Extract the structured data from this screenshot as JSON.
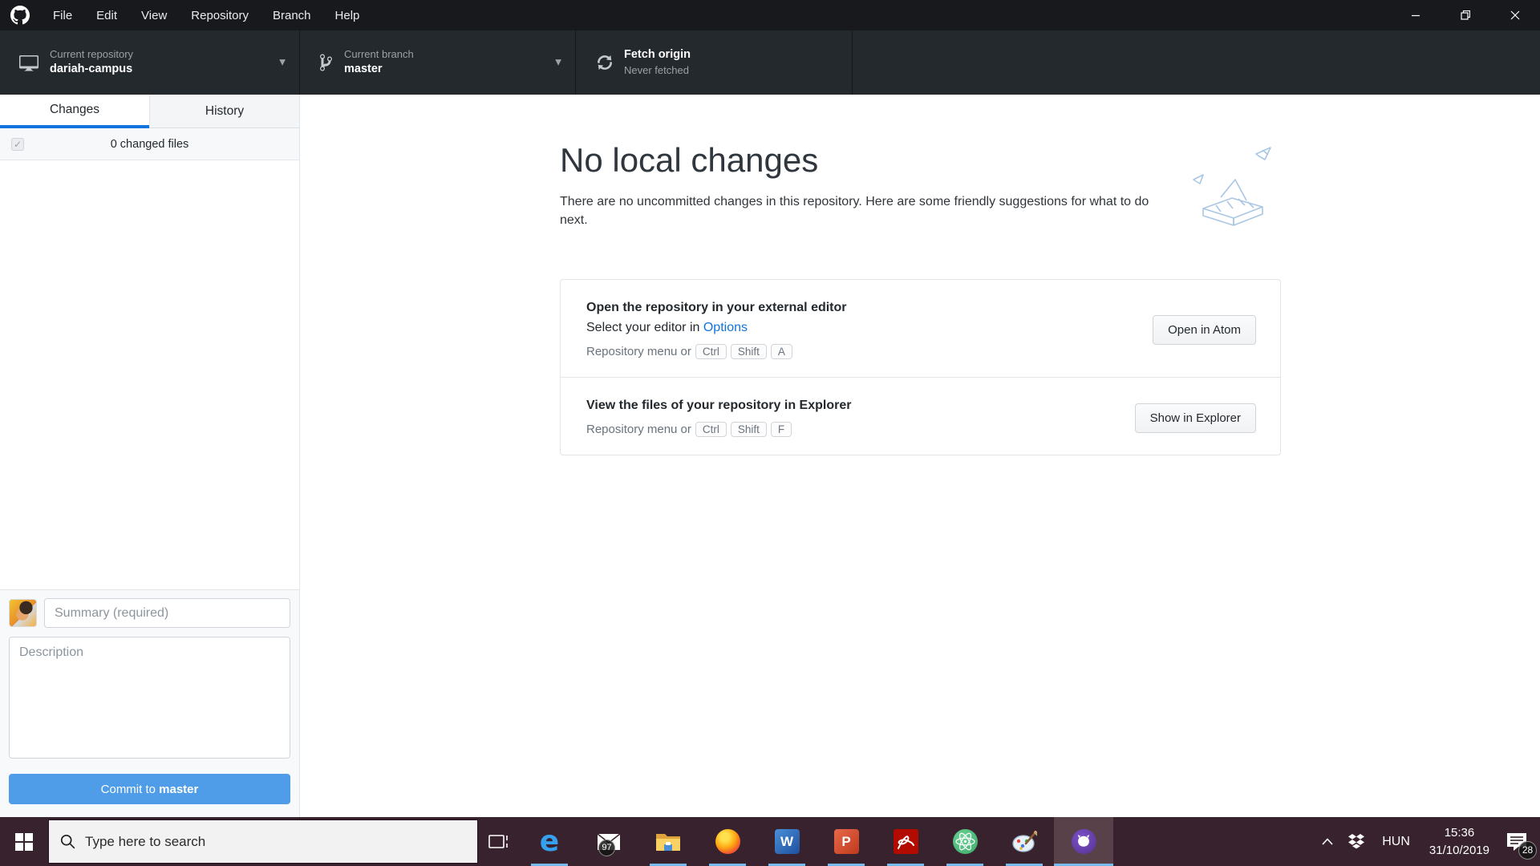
{
  "titlebar": {
    "menu_items": [
      "File",
      "Edit",
      "View",
      "Repository",
      "Branch",
      "Help"
    ]
  },
  "toolbar": {
    "repository": {
      "label": "Current repository",
      "value": "dariah-campus"
    },
    "branch": {
      "label": "Current branch",
      "value": "master"
    },
    "fetch": {
      "label": "Fetch origin",
      "sublabel": "Never fetched"
    }
  },
  "sidebar": {
    "tabs": [
      {
        "label": "Changes"
      },
      {
        "label": "History"
      }
    ],
    "changed_files": "0 changed files",
    "commit": {
      "summary_placeholder": "Summary (required)",
      "description_placeholder": "Description",
      "button_prefix": "Commit to ",
      "button_branch": "master"
    }
  },
  "main": {
    "title": "No local changes",
    "subtitle": "There are no uncommitted changes in this repository. Here are some friendly suggestions for what to do next.",
    "suggestions": [
      {
        "title": "Open the repository in your external editor",
        "line2_prefix": "Select your editor in ",
        "line2_link": "Options",
        "shortcut_prefix": "Repository menu or",
        "keys": [
          "Ctrl",
          "Shift",
          "A"
        ],
        "button": "Open in Atom"
      },
      {
        "title": "View the files of your repository in Explorer",
        "shortcut_prefix": "Repository menu or",
        "keys": [
          "Ctrl",
          "Shift",
          "F"
        ],
        "button": "Show in Explorer"
      }
    ]
  },
  "taskbar": {
    "search_placeholder": "Type here to search",
    "language": "HUN",
    "time": "15:36",
    "date": "31/10/2019",
    "badges": {
      "mail": "97",
      "notifications": "28"
    },
    "glyphs": {
      "edge": "e",
      "word": "W",
      "powerpoint": "P"
    },
    "icons": [
      "start",
      "search",
      "task-view",
      "edge",
      "mail",
      "file-explorer",
      "firefox",
      "word",
      "powerpoint",
      "acrobat",
      "atom",
      "paint",
      "github-desktop",
      "tray-expand",
      "dropbox",
      "language",
      "clock",
      "action-center"
    ]
  },
  "colors": {
    "titlebar_bg": "#17191d",
    "toolbar_bg": "#24292e",
    "accent_blue": "#1173dd",
    "commit_button_blue": "#4f9de8",
    "taskbar_bg": "#38222d",
    "taskbar_highlight": "#584149",
    "taskbar_underline": "#76b9ed",
    "card_border": "#e1e4e8",
    "muted_text": "#6a737d",
    "illustration_blue": "#a9c7e4"
  }
}
